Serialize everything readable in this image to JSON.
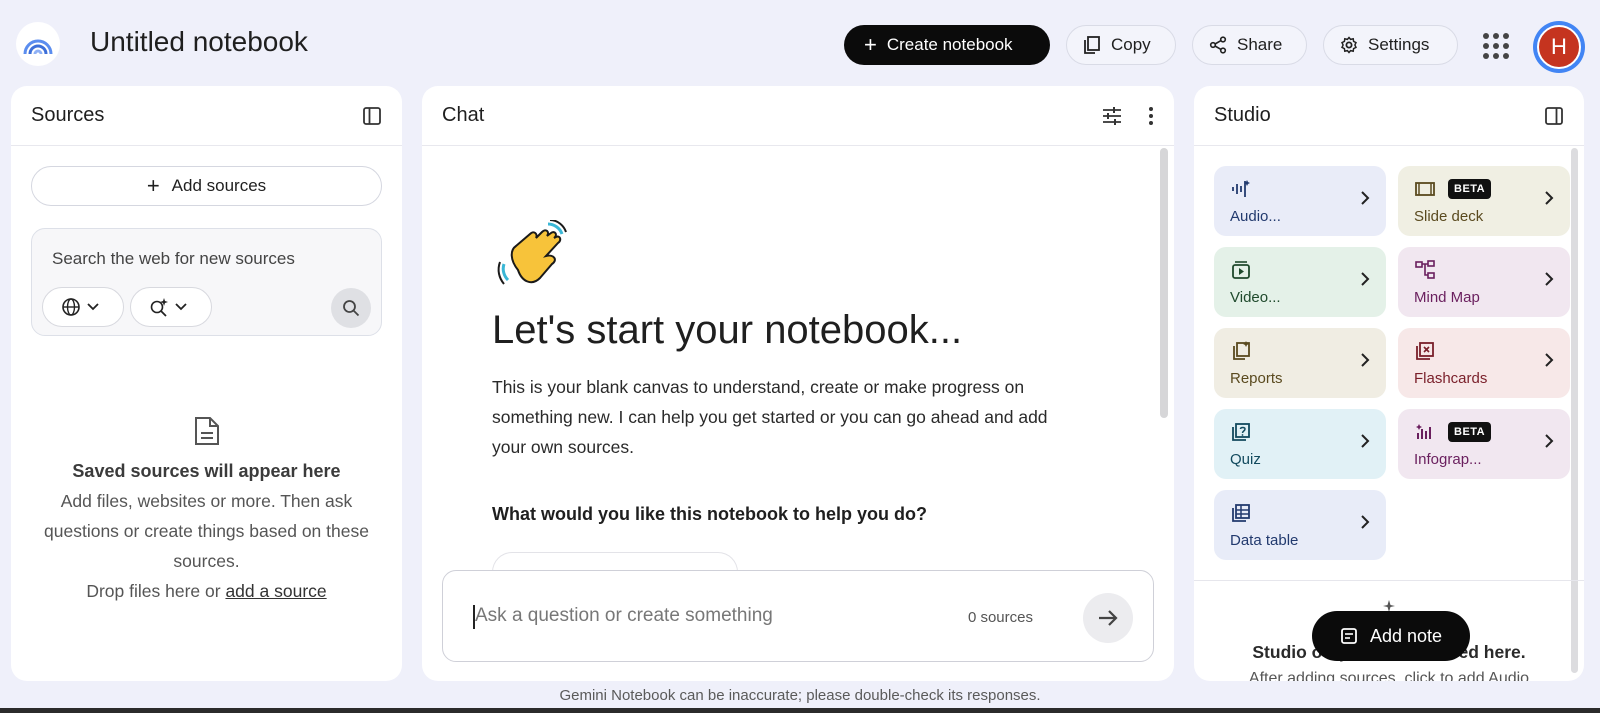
{
  "header": {
    "title": "Untitled notebook",
    "create_label": "Create notebook",
    "copy_label": "Copy",
    "share_label": "Share",
    "settings_label": "Settings",
    "avatar_letter": "H"
  },
  "sources": {
    "title": "Sources",
    "add_label": "Add sources",
    "search_placeholder": "Search the web for new sources",
    "empty_title": "Saved sources will appear here",
    "empty_text": "Add files, websites or more. Then ask questions or create things based on these sources.",
    "drop_text": "Drop files here or",
    "drop_link": "add a source"
  },
  "chat": {
    "title": "Chat",
    "heading": "Let's start your notebook...",
    "intro": "This is your blank canvas to understand, create or make progress on something new. I can help you get started or you can go ahead and add your own sources.",
    "question": "What would you like this notebook to help you do?",
    "input_placeholder": "Ask a question or create something",
    "source_count": "0 sources"
  },
  "studio": {
    "title": "Studio",
    "beta_label": "BETA",
    "cards": [
      {
        "label": "Audio...",
        "icon": "audio-icon",
        "bg": "#e9ecf8",
        "color": "#223a6e",
        "beta": false
      },
      {
        "label": "Slide deck",
        "icon": "slide-icon",
        "bg": "#f0efe3",
        "color": "#5a4a1f",
        "beta": true
      },
      {
        "label": "Video...",
        "icon": "video-icon",
        "bg": "#e4f1e8",
        "color": "#1f4a2c",
        "beta": false
      },
      {
        "label": "Mind Map",
        "icon": "mindmap-icon",
        "bg": "#f1e7f0",
        "color": "#6a1f5e",
        "beta": false
      },
      {
        "label": "Reports",
        "icon": "reports-icon",
        "bg": "#f0ede3",
        "color": "#5a4a1f",
        "beta": false
      },
      {
        "label": "Flashcards",
        "icon": "flashcards-icon",
        "bg": "#f7e8e8",
        "color": "#7a1f2a",
        "beta": false
      },
      {
        "label": "Quiz",
        "icon": "quiz-icon",
        "bg": "#e1f1f6",
        "color": "#124a5e",
        "beta": false
      },
      {
        "label": "Infograp...",
        "icon": "infographic-icon",
        "bg": "#f1e7f0",
        "color": "#6a1f5e",
        "beta": true
      },
      {
        "label": "Data table",
        "icon": "table-icon",
        "bg": "#e8ecf8",
        "color": "#223a6e",
        "beta": false
      }
    ],
    "empty_title": "Studio output will be saved here.",
    "empty_sub": "After adding sources, click to add Audio",
    "add_note_label": "Add note"
  },
  "footer": {
    "disclaimer": "Gemini Notebook can be inaccurate; please double-check its responses."
  }
}
